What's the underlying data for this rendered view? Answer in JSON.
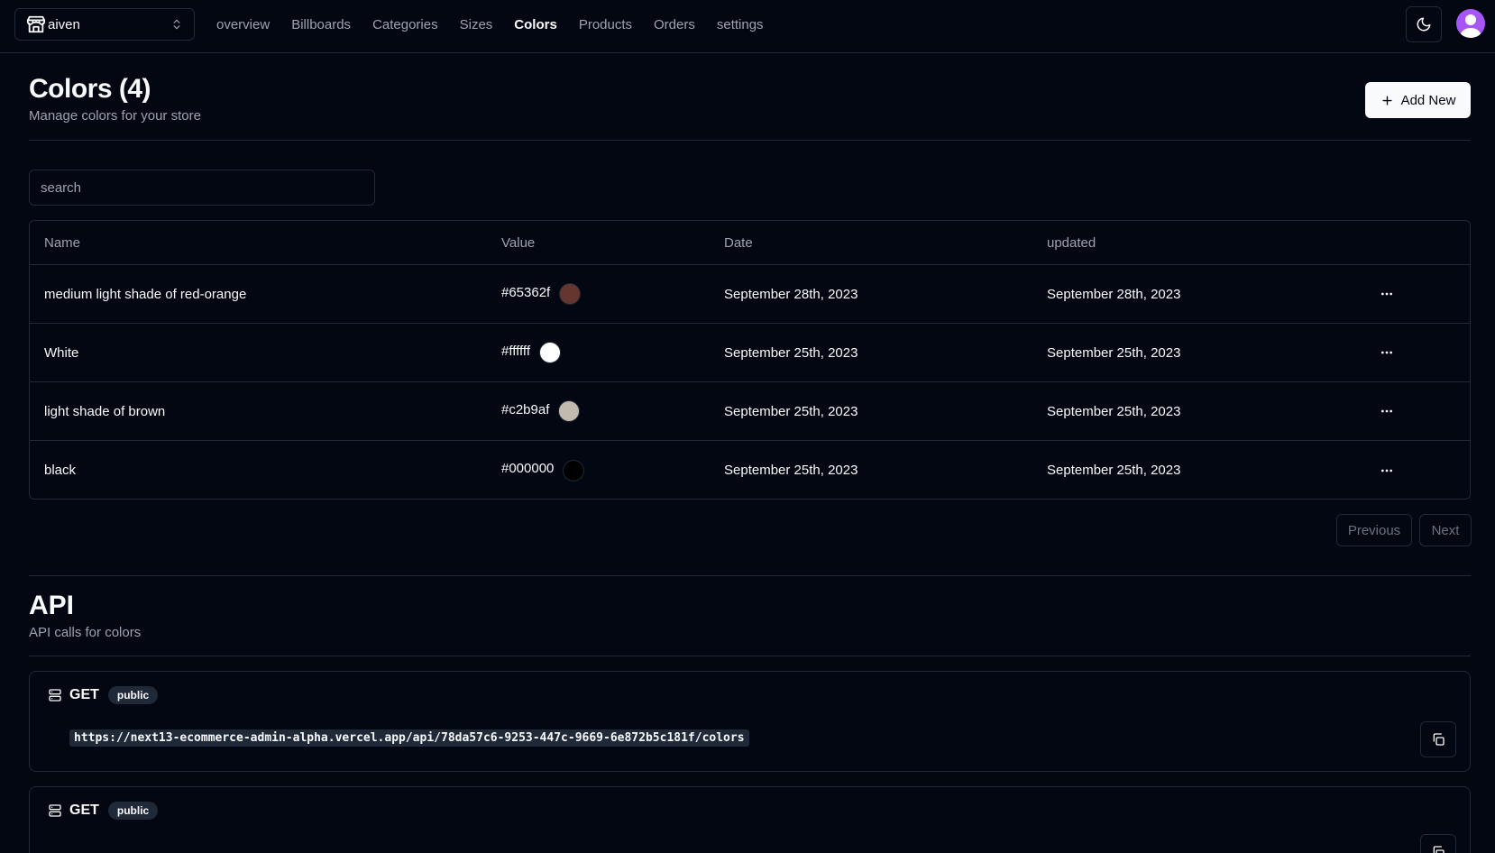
{
  "store_switcher": {
    "label": "aiven"
  },
  "nav": [
    {
      "label": "overview",
      "active": false
    },
    {
      "label": "Billboards",
      "active": false
    },
    {
      "label": "Categories",
      "active": false
    },
    {
      "label": "Sizes",
      "active": false
    },
    {
      "label": "Colors",
      "active": true
    },
    {
      "label": "Products",
      "active": false
    },
    {
      "label": "Orders",
      "active": false
    },
    {
      "label": "settings",
      "active": false
    }
  ],
  "header": {
    "title": "Colors (4)",
    "description": "Manage colors for your store",
    "add_button": "Add New"
  },
  "search": {
    "placeholder": "search",
    "value": ""
  },
  "table": {
    "columns": {
      "name": "Name",
      "value": "Value",
      "date": "Date",
      "updated": "updated"
    },
    "rows": [
      {
        "name": "medium light shade of red-orange",
        "value": "#65362f",
        "date": "September 28th, 2023",
        "updated": "September 28th, 2023"
      },
      {
        "name": "White",
        "value": "#ffffff",
        "date": "September 25th, 2023",
        "updated": "September 25th, 2023"
      },
      {
        "name": "light shade of brown",
        "value": "#c2b9af",
        "date": "September 25th, 2023",
        "updated": "September 25th, 2023"
      },
      {
        "name": "black",
        "value": "#000000",
        "date": "September 25th, 2023",
        "updated": "September 25th, 2023"
      }
    ]
  },
  "pagination": {
    "previous": "Previous",
    "next": "Next"
  },
  "api": {
    "title": "API",
    "description": "API calls for colors",
    "calls": [
      {
        "method": "GET",
        "badge": "public",
        "url": "https://next13-ecommerce-admin-alpha.vercel.app/api/78da57c6-9253-447c-9669-6e872b5c181f/colors"
      },
      {
        "method": "GET",
        "badge": "public",
        "url": ""
      }
    ]
  }
}
